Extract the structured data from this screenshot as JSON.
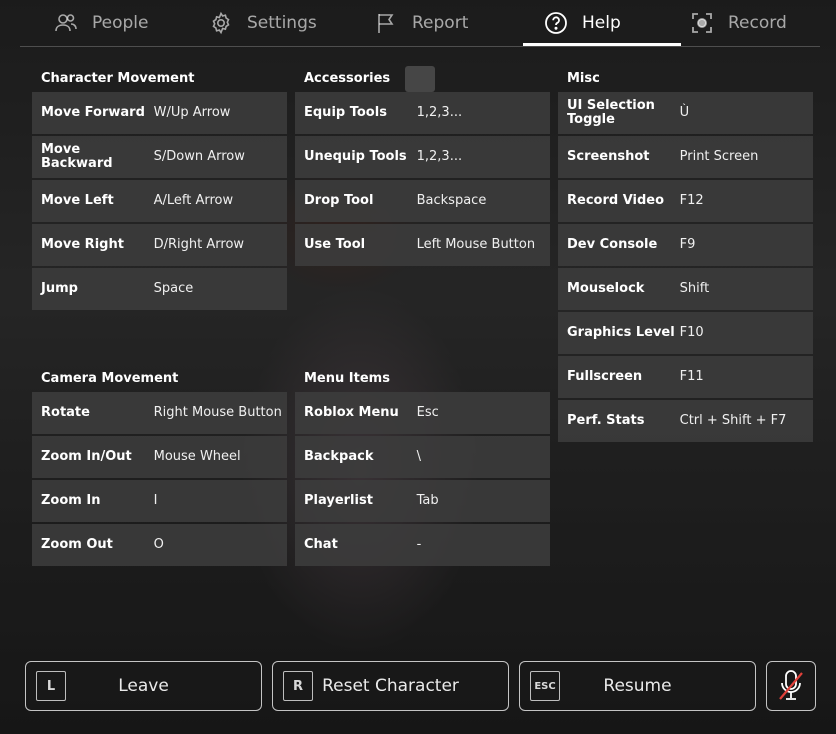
{
  "tabs": [
    {
      "label": "People",
      "icon": "people-icon"
    },
    {
      "label": "Settings",
      "icon": "gear-icon"
    },
    {
      "label": "Report",
      "icon": "flag-icon"
    },
    {
      "label": "Help",
      "icon": "question-icon",
      "active": true
    },
    {
      "label": "Record",
      "icon": "record-icon"
    }
  ],
  "sections": {
    "character": {
      "title": "Character Movement",
      "rows": [
        {
          "k": "Move Forward",
          "v": "W/Up Arrow"
        },
        {
          "k": "Move Backward",
          "v": "S/Down Arrow"
        },
        {
          "k": "Move Left",
          "v": "A/Left Arrow"
        },
        {
          "k": "Move Right",
          "v": "D/Right Arrow"
        },
        {
          "k": "Jump",
          "v": "Space"
        }
      ]
    },
    "accessories": {
      "title": "Accessories",
      "rows": [
        {
          "k": "Equip Tools",
          "v": "1,2,3..."
        },
        {
          "k": "Unequip Tools",
          "v": "1,2,3..."
        },
        {
          "k": "Drop Tool",
          "v": "Backspace"
        },
        {
          "k": "Use Tool",
          "v": "Left Mouse Button"
        }
      ]
    },
    "misc": {
      "title": "Misc",
      "rows": [
        {
          "k": "UI Selection Toggle",
          "v": "Ù"
        },
        {
          "k": "Screenshot",
          "v": "Print Screen"
        },
        {
          "k": "Record Video",
          "v": "F12"
        },
        {
          "k": "Dev Console",
          "v": "F9"
        },
        {
          "k": "Mouselock",
          "v": "Shift"
        },
        {
          "k": "Graphics Level",
          "v": "F10"
        },
        {
          "k": "Fullscreen",
          "v": "F11"
        },
        {
          "k": "Perf. Stats",
          "v": "Ctrl + Shift + F7"
        }
      ]
    },
    "camera": {
      "title": "Camera Movement",
      "rows": [
        {
          "k": "Rotate",
          "v": "Right Mouse Button"
        },
        {
          "k": "Zoom In/Out",
          "v": "Mouse Wheel"
        },
        {
          "k": "Zoom In",
          "v": "I"
        },
        {
          "k": "Zoom Out",
          "v": "O"
        }
      ]
    },
    "menu": {
      "title": "Menu Items",
      "rows": [
        {
          "k": "Roblox Menu",
          "v": "Esc"
        },
        {
          "k": "Backpack",
          "v": "\\"
        },
        {
          "k": "Playerlist",
          "v": "Tab"
        },
        {
          "k": "Chat",
          "v": "-"
        }
      ]
    }
  },
  "bottom": {
    "leave": {
      "key": "L",
      "label": "Leave"
    },
    "reset": {
      "key": "R",
      "label": "Reset Character"
    },
    "resume": {
      "key": "ESC",
      "label": "Resume"
    }
  }
}
